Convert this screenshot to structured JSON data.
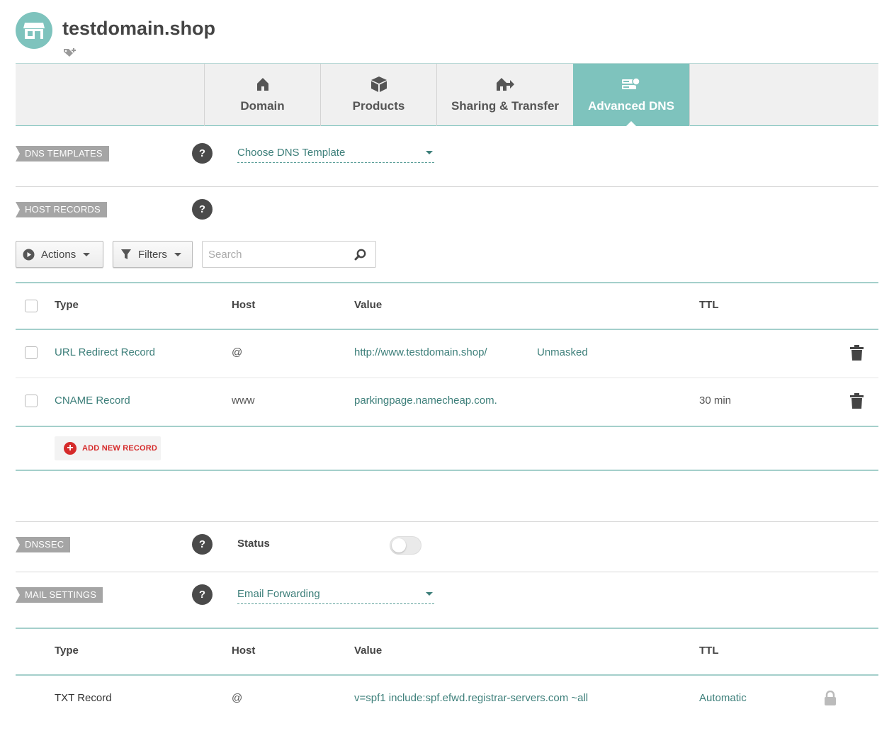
{
  "header": {
    "domain": "testdomain.shop",
    "avatar_icon": "store-icon",
    "tag_icon": "tag-add-icon"
  },
  "tabs": [
    {
      "label": "Domain",
      "icon": "home-icon",
      "active": false
    },
    {
      "label": "Products",
      "icon": "box-icon",
      "active": false
    },
    {
      "label": "Sharing & Transfer",
      "icon": "share-transfer-icon",
      "active": false
    },
    {
      "label": "Advanced DNS",
      "icon": "server-icon",
      "active": true
    }
  ],
  "dns_templates": {
    "label": "DNS TEMPLATES",
    "help": "?",
    "select_value": "Choose DNS Template"
  },
  "host_records": {
    "label": "HOST RECORDS",
    "help": "?",
    "actions_label": "Actions",
    "filters_label": "Filters",
    "search_placeholder": "Search",
    "columns": {
      "type": "Type",
      "host": "Host",
      "value": "Value",
      "ttl": "TTL"
    },
    "rows": [
      {
        "type": "URL Redirect Record",
        "host": "@",
        "value": "http://www.testdomain.shop/",
        "extra": "Unmasked",
        "ttl": ""
      },
      {
        "type": "CNAME Record",
        "host": "www",
        "value": "parkingpage.namecheap.com.",
        "extra": "",
        "ttl": "30 min"
      }
    ],
    "add_label": "ADD NEW RECORD"
  },
  "dnssec": {
    "label": "DNSSEC",
    "help": "?",
    "status_label": "Status",
    "enabled": false
  },
  "mail_settings": {
    "label": "MAIL SETTINGS",
    "help": "?",
    "select_value": "Email Forwarding",
    "columns": {
      "type": "Type",
      "host": "Host",
      "value": "Value",
      "ttl": "TTL"
    },
    "rows": [
      {
        "type": "TXT Record",
        "host": "@",
        "value": "v=spf1 include:spf.efwd.registrar-servers.com ~all",
        "ttl": "Automatic"
      }
    ]
  },
  "colors": {
    "accent": "#7ec3bd",
    "link": "#3d7f7a",
    "danger": "#d52b2b",
    "label_bg": "#a5a5a5"
  }
}
